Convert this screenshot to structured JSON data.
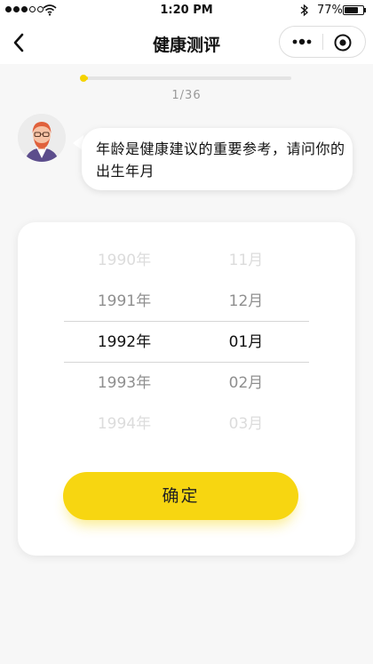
{
  "status_bar": {
    "time": "1:20 PM",
    "battery": "77%",
    "battery_level": 0.77
  },
  "nav": {
    "title": "健康测评",
    "back_icon": "chevron-left-icon",
    "more_icon": "more-dots-icon",
    "close_icon": "target-circle-icon"
  },
  "progress": {
    "current": 1,
    "total": 36,
    "text": "1/36",
    "accent": "#f5d300"
  },
  "question": {
    "avatar_icon": "avatar-man-icon",
    "text": "年龄是健康建议的重要参考，请问你的出生年月"
  },
  "picker": {
    "years": [
      "1990年",
      "1991年",
      "1992年",
      "1993年",
      "1994年"
    ],
    "months": [
      "11月",
      "12月",
      "01月",
      "02月",
      "03月"
    ],
    "selected_year": "1992年",
    "selected_month": "01月"
  },
  "confirm_label": "确定",
  "colors": {
    "primary_yellow": "#f7d611",
    "background": "#f7f7f7"
  }
}
